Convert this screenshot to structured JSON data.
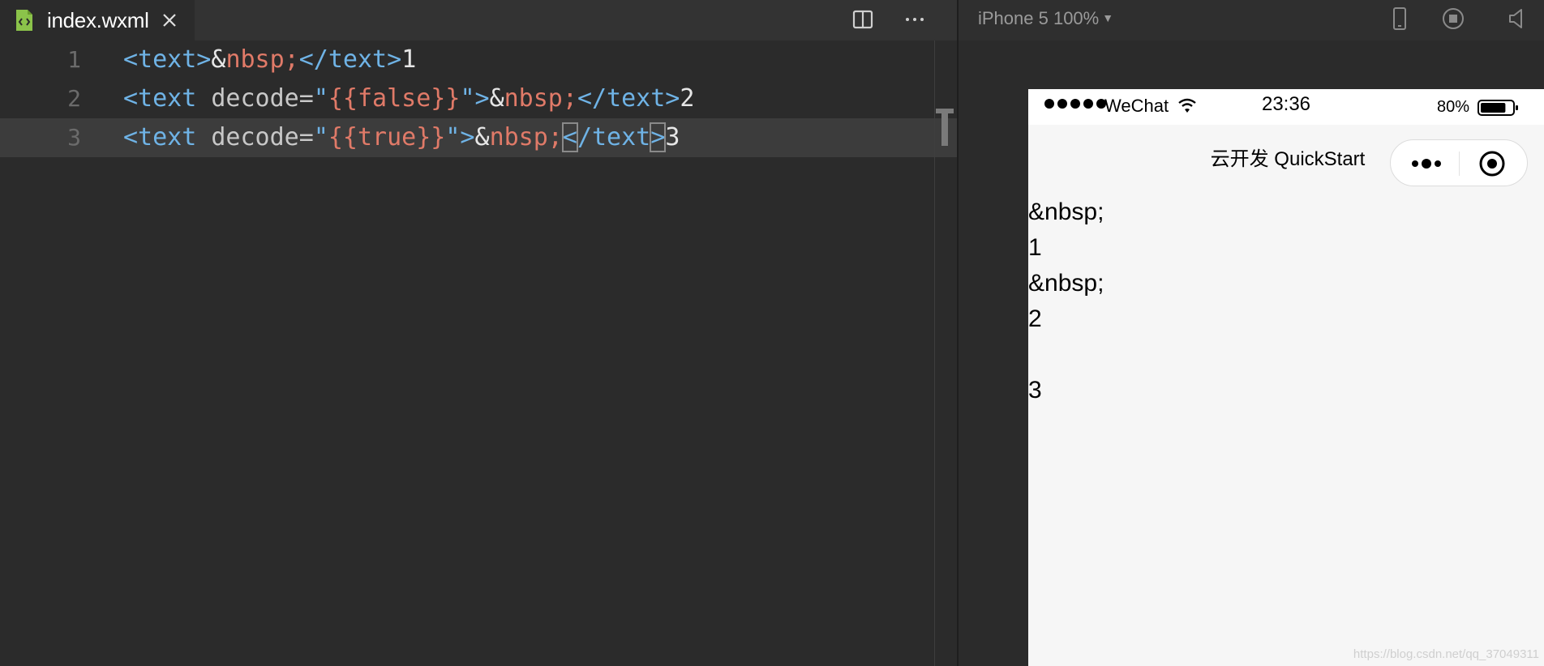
{
  "editor": {
    "tab": {
      "label": "index.wxml"
    },
    "lines": [
      {
        "number": "1",
        "tokens": [
          {
            "t": "<text>",
            "c": "t-tag"
          },
          {
            "t": "&",
            "c": "t-txt"
          },
          {
            "t": "nbsp;",
            "c": "t-ent"
          },
          {
            "t": "</text>",
            "c": "t-tag"
          },
          {
            "t": "1",
            "c": "t-txt"
          }
        ]
      },
      {
        "number": "2",
        "tokens": [
          {
            "t": "<text",
            "c": "t-tag"
          },
          {
            "t": " decode=",
            "c": "t-attr"
          },
          {
            "t": "\"",
            "c": "t-tag"
          },
          {
            "t": "{{false}}",
            "c": "t-val"
          },
          {
            "t": "\">",
            "c": "t-tag"
          },
          {
            "t": "&",
            "c": "t-txt"
          },
          {
            "t": "nbsp;",
            "c": "t-ent"
          },
          {
            "t": "</text>",
            "c": "t-tag"
          },
          {
            "t": "2",
            "c": "t-txt"
          }
        ]
      },
      {
        "number": "3",
        "active": true,
        "tokens": [
          {
            "t": "<text",
            "c": "t-tag"
          },
          {
            "t": " decode=",
            "c": "t-attr"
          },
          {
            "t": "\"",
            "c": "t-tag"
          },
          {
            "t": "{{true}}",
            "c": "t-val"
          },
          {
            "t": "\">",
            "c": "t-tag"
          },
          {
            "t": "&",
            "c": "t-txt"
          },
          {
            "t": "nbsp;",
            "c": "t-ent"
          },
          {
            "t": "<",
            "c": "t-tag caretbox"
          },
          {
            "t": "/text",
            "c": "t-tag"
          },
          {
            "t": ">",
            "c": "t-tag caretbox"
          },
          {
            "t": "3",
            "c": "t-txt"
          }
        ]
      }
    ]
  },
  "simulator": {
    "device_label": "iPhone 5 100%",
    "status_bar": {
      "carrier": "WeChat",
      "time": "23:36",
      "battery": "80%",
      "battery_level": 0.8
    },
    "nav_title": "云开发 QuickStart",
    "output_lines": [
      "&nbsp;",
      "1",
      "&nbsp;",
      "2",
      " ",
      "3"
    ],
    "watermark": "https://blog.csdn.net/qq_37049311"
  },
  "colors": {
    "tag": "#6fb3e6",
    "entity": "#e07a68",
    "attribute": "#c8c8c8",
    "editor_bg": "#2b2b2b",
    "file_icon": "#8bc34a"
  }
}
